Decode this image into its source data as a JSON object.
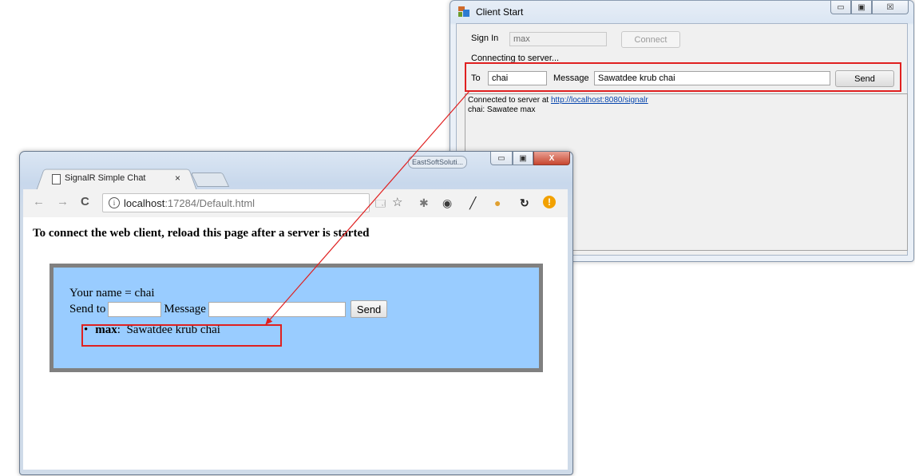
{
  "client_window": {
    "title": "Client Start",
    "sign_in_label": "Sign In",
    "sign_in_value": "max",
    "connect_label": "Connect",
    "status": "Connecting to server...",
    "to_label": "To",
    "to_value": "chai",
    "message_label": "Message",
    "message_value": "Sawatdee krub chai",
    "send_label": "Send",
    "log_prefix": "Connected to server at ",
    "log_link": "http://localhost:8080/signalr",
    "log_line2": "chai: Sawatee max",
    "caption_buttons": {
      "minimize": "▭",
      "maximize": "▣",
      "close": "☒"
    }
  },
  "browser": {
    "taskbar_badge": "EastSoftSoluti...",
    "tab_title": "SignalR Simple Chat",
    "tab_close": "×",
    "url_host": "localhost",
    "url_path": ":17284/Default.html",
    "caption_buttons": {
      "minimize": "▭",
      "maximize": "▣",
      "close": "X"
    },
    "icons": [
      "back-icon",
      "forward-icon",
      "reload-icon",
      "info-icon",
      "translate-icon",
      "star-icon",
      "extension-bug-icon",
      "extension-ring-icon",
      "extension-pen-icon",
      "extension-cookie-icon",
      "extension-sync-icon",
      "extension-alert-icon"
    ],
    "nav_glyphs": {
      "back": "←",
      "forward": "→",
      "reload": "C",
      "info": "i",
      "translate": "🗔",
      "star": "☆",
      "bug": "✱",
      "ring": "◉",
      "pen": "╱",
      "cookie": "●",
      "sync": "↻",
      "alert": "!"
    }
  },
  "page": {
    "heading": "To connect the web client, reload this page after a server is started",
    "your_name_label": "Your name = ",
    "your_name_value": "chai",
    "send_to_label": "Send to",
    "message_label": "Message",
    "send_label": "Send",
    "messages": [
      {
        "sender": "max",
        "separator": ":",
        "text": "Sawatdee krub chai"
      }
    ]
  },
  "colors": {
    "chat_box_bg": "#99ccff",
    "chat_box_border": "#808080",
    "highlight": "#e02020"
  }
}
